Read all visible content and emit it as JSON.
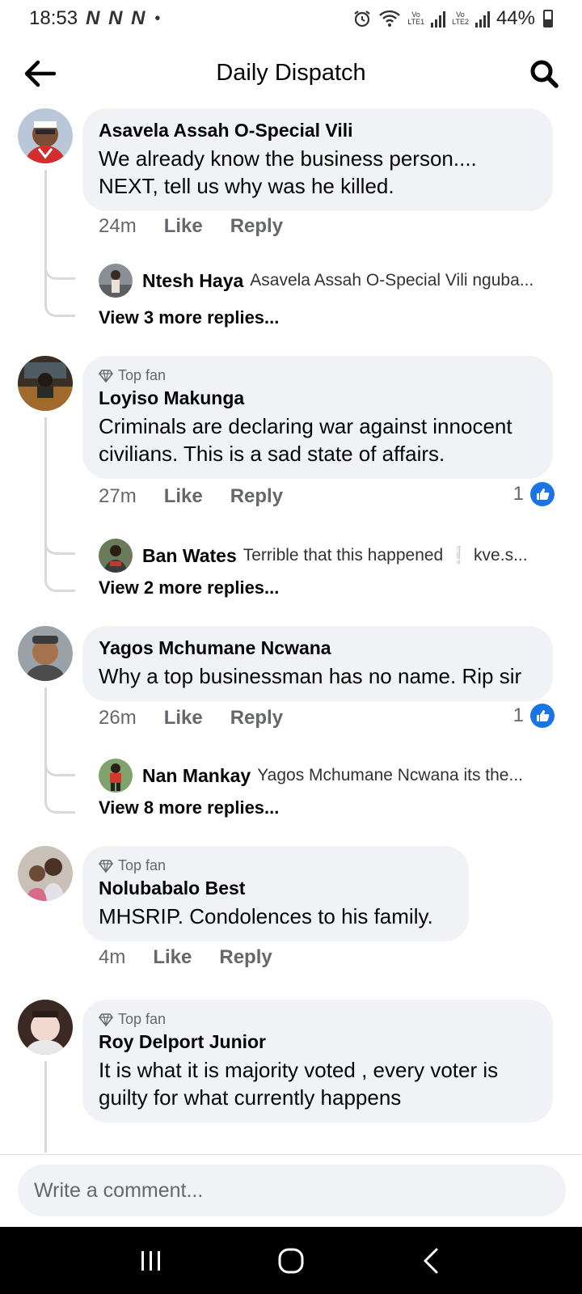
{
  "status_bar": {
    "time": "18:53",
    "carrier_icons": "N N N",
    "battery": "44%",
    "lte1": "LTE1",
    "lte2": "LTE2",
    "vo": "Vo"
  },
  "header": {
    "title": "Daily Dispatch",
    "back_icon": "arrow-left-icon",
    "search_icon": "search-icon"
  },
  "comments": [
    {
      "author": "Asavela Assah O-Special Vili",
      "top_fan": "",
      "text": "We already know the business person.... NEXT, tell us why was he killed.",
      "time": "24m",
      "like": "Like",
      "reply": "Reply",
      "reactions": "",
      "reply_preview": {
        "author": "Ntesh Haya",
        "text": "Asavela Assah O-Special Vili nguba..."
      },
      "view_more": "View 3 more replies..."
    },
    {
      "author": "Loyiso Makunga",
      "top_fan": "Top fan",
      "text": "Criminals are declaring war against innocent civilians. This is a sad state of affairs.",
      "time": "27m",
      "like": "Like",
      "reply": "Reply",
      "reactions": "1",
      "reply_preview": {
        "author": "Ban Wates",
        "text": "Terrible that this happened  ❕  kve.s..."
      },
      "view_more": "View 2 more replies..."
    },
    {
      "author": "Yagos Mchumane Ncwana",
      "top_fan": "",
      "text": "Why a top businessman has no name. Rip sir",
      "time": "26m",
      "like": "Like",
      "reply": "Reply",
      "reactions": "1",
      "reply_preview": {
        "author": "Nan Mankay",
        "text": "Yagos Mchumane Ncwana its the..."
      },
      "view_more": "View 8 more replies..."
    },
    {
      "author": "Nolubabalo Best",
      "top_fan": "Top fan",
      "text": "MHSRIP. Condolences to his family.",
      "time": "4m",
      "like": "Like",
      "reply": "Reply",
      "reactions": ""
    },
    {
      "author": "Roy Delport Junior",
      "top_fan": "Top fan",
      "text": "It is what it is majority voted , every voter is guilty for what currently happens"
    }
  ],
  "composer": {
    "placeholder": "Write a comment..."
  },
  "colors": {
    "bubble": "#f0f2f5",
    "meta_text": "#65676b",
    "like_blue": "#1b74e4",
    "nav_bar": "#000000"
  }
}
